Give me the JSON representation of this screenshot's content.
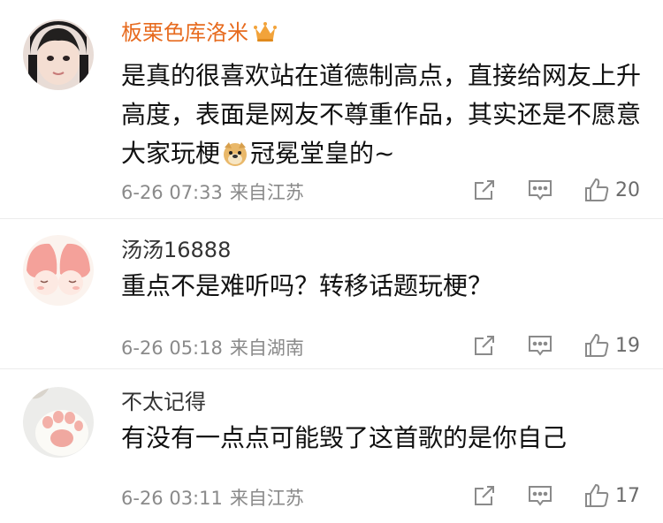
{
  "comments": [
    {
      "username": "板栗色库洛米",
      "text_part1": "是真的很喜欢站在道德制高点，直接给网友上升高度，表面是网友不尊重作品，其实还是不愿意大家玩梗",
      "text_part2": "冠冕堂皇的~",
      "date": "6-26 07:33",
      "location": "来自江苏",
      "likes": "20"
    },
    {
      "username": "汤汤16888",
      "text": "重点不是难听吗？转移话题玩梗？",
      "date": "6-26 05:18",
      "location": "来自湖南",
      "likes": "19"
    },
    {
      "username": "不太记得",
      "text": "有没有一点点可能毁了这首歌的是你自己",
      "date": "6-26 03:11",
      "location": "来自江苏",
      "likes": "17"
    }
  ],
  "colors": {
    "vip_name": "#e76b1f",
    "crown": "#f2a33a",
    "icon": "#8a8a8a"
  },
  "icons": [
    "crown-icon",
    "doge-emoji-icon",
    "share-icon",
    "comment-icon",
    "like-icon"
  ]
}
